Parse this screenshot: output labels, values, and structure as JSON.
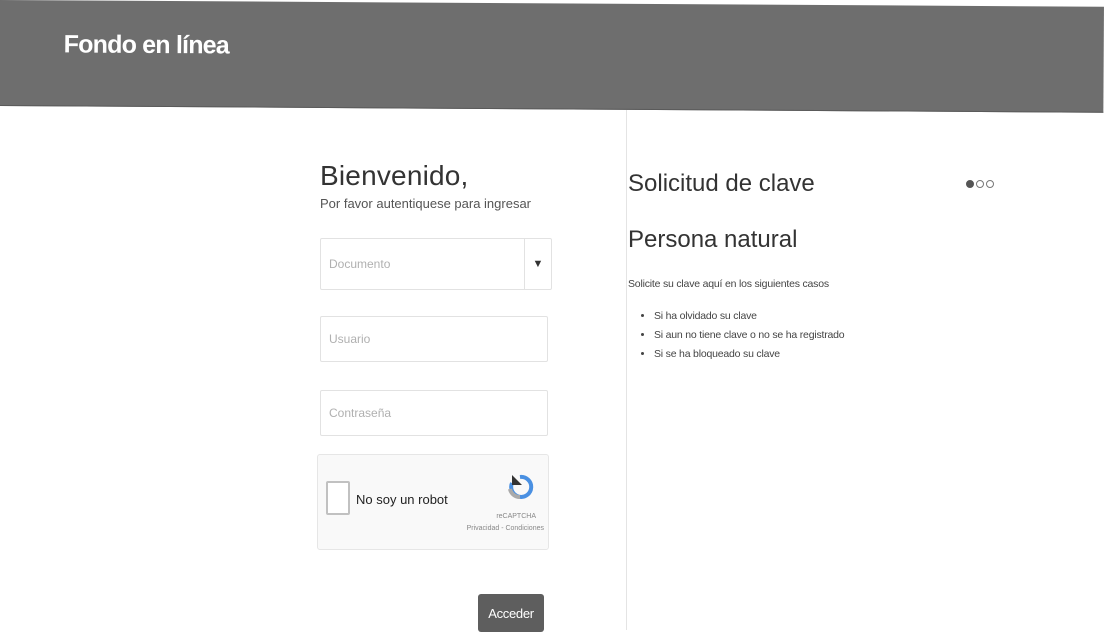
{
  "header": {
    "brand": "Fondo en línea"
  },
  "login": {
    "title": "Bienvenido,",
    "subtitle": "Por favor autentiquese para ingresar",
    "document_placeholder": "Documento",
    "user_placeholder": "Usuario",
    "password_placeholder": "Contraseña",
    "captcha_label": "No soy un robot",
    "captcha_brand": "reCAPTCHA",
    "captcha_links": "Privacidad - Condiciones",
    "submit_label": "Acceder"
  },
  "info": {
    "title": "Solicitud de clave",
    "subtitle": "Persona natural",
    "intro": "Solicite su clave aquí en los siguientes casos",
    "cases": [
      "Si ha olvidado su clave",
      "Si aun no tiene clave o no se ha registrado",
      "Si se ha bloqueado su clave"
    ]
  },
  "carousel": {
    "active_index": 0,
    "total": 3
  }
}
